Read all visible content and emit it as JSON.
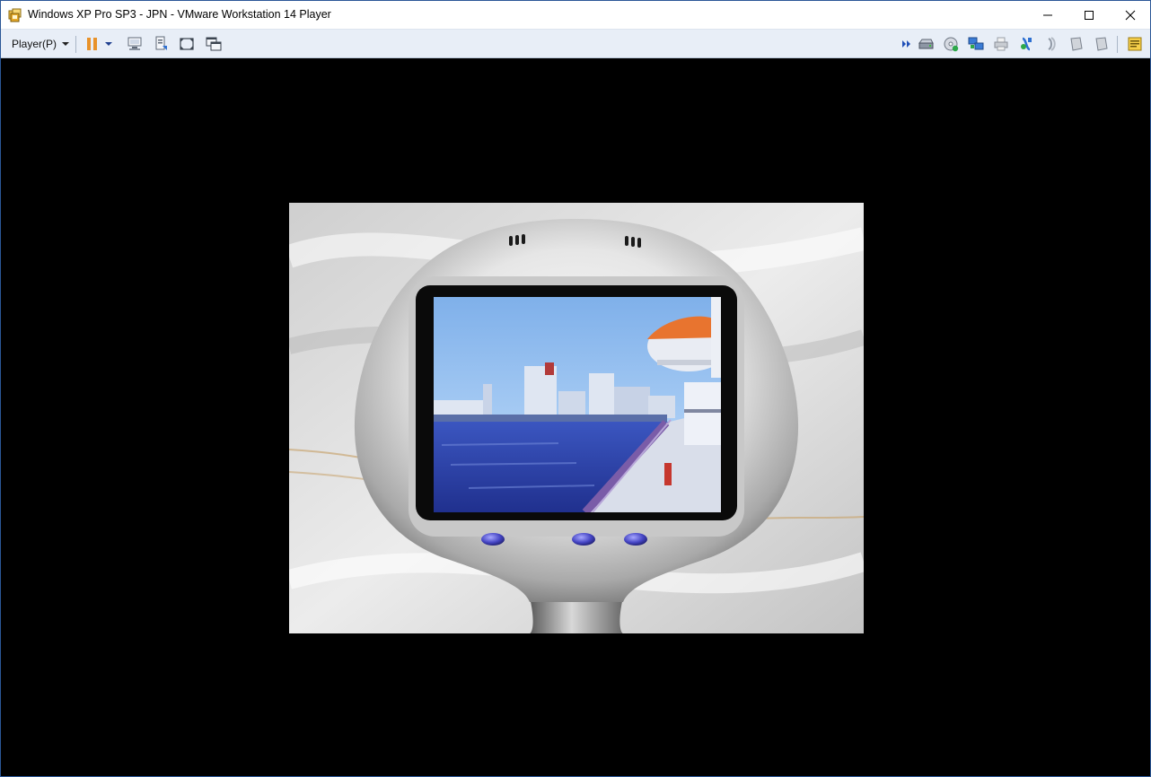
{
  "window": {
    "title": "Windows XP Pro SP3 - JPN - VMware Workstation 14 Player"
  },
  "toolbar": {
    "player_menu_label": "Player(P)"
  },
  "colors": {
    "titlebar_bg": "#ffffff",
    "toolbar_bg": "#e8eef7",
    "pause_orange": "#e8922a",
    "device_button_blue": "#4a4ac8",
    "sky": "#9ec8f0",
    "water": "#2a3aa8"
  },
  "icons": [
    "vmware-app-icon",
    "minimize-icon",
    "maximize-icon",
    "close-icon",
    "pause-icon",
    "send-ctrl-alt-del-icon",
    "snapshot-icon",
    "fullscreen-icon",
    "unity-icon",
    "more-devices-icon",
    "hard-disk-icon",
    "cd-dvd-icon",
    "network-adapter-icon",
    "printer-icon",
    "usb-icon",
    "sound-card-icon",
    "floppy-icon",
    "message-log-icon"
  ]
}
